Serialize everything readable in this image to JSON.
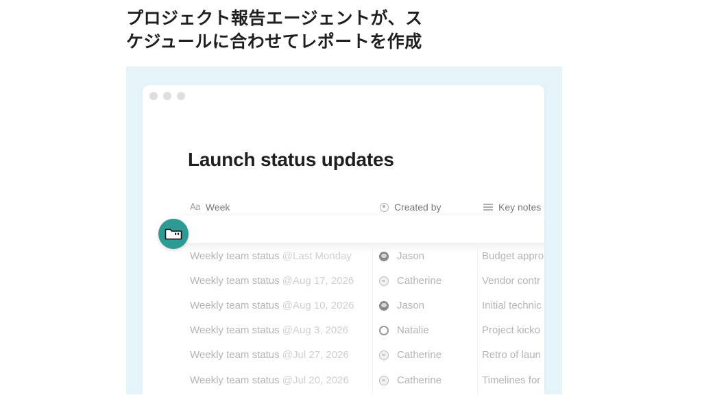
{
  "headline": {
    "line1": "プロジェクト報告エージェントが、ス",
    "line2": "ケジュールに合わせてレポートを作成"
  },
  "colors": {
    "panel_bg": "#e4f4f9",
    "badge_bg": "#2d9a93",
    "text_dark": "#1f1f1f",
    "text_faded": "#b4b4b4"
  },
  "page": {
    "title": "Launch status updates"
  },
  "table": {
    "columns": [
      {
        "label": "Week",
        "icon": "text-property-icon",
        "icon_text": "Aa"
      },
      {
        "label": "Created by",
        "icon": "person-property-icon"
      },
      {
        "label": "Key notes",
        "icon": "list-property-icon"
      }
    ],
    "rows": [
      {
        "week": "Weekly team status",
        "date": "@Last Monday",
        "creator": "Jason",
        "avatar": "dark",
        "notes": "Budget appro"
      },
      {
        "week": "Weekly team status",
        "date": "@Aug 17, 2026",
        "creator": "Catherine",
        "avatar": "light",
        "notes": "Vendor contr"
      },
      {
        "week": "Weekly team status",
        "date": "@Aug 10, 2026",
        "creator": "Jason",
        "avatar": "dark",
        "notes": "Initial technic"
      },
      {
        "week": "Weekly team status",
        "date": "@Aug 3, 2026",
        "creator": "Natalie",
        "avatar": "hair",
        "notes": "Project kicko"
      },
      {
        "week": "Weekly team status",
        "date": "@Jul 27, 2026",
        "creator": "Catherine",
        "avatar": "light",
        "notes": "Retro of laun"
      },
      {
        "week": "Weekly team status",
        "date": "@Jul 20, 2026",
        "creator": "Catherine",
        "avatar": "light",
        "notes": "Timelines for"
      }
    ]
  },
  "badge": {
    "icon": "folder-icon"
  }
}
